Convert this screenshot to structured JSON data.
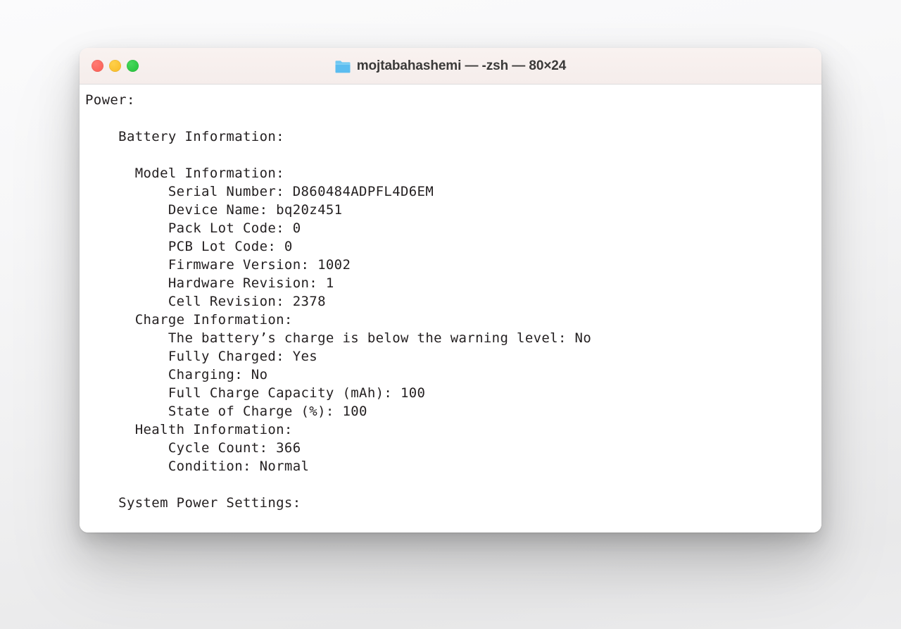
{
  "window": {
    "title": "mojtabahashemi — -zsh — 80×24",
    "folder_icon": "folder-icon",
    "traffic_lights": {
      "close": {
        "name": "close",
        "color": "#FF5F57"
      },
      "minimize": {
        "name": "minimize",
        "color": "#FEBC2E"
      },
      "maximize": {
        "name": "maximize",
        "color": "#28C840"
      }
    },
    "size": {
      "columns": 80,
      "rows": 24
    },
    "shell": "-zsh",
    "user": "mojtabahashemi"
  },
  "theme": {
    "titlebar_bg": "#F6EEEC",
    "body_bg": "#FFFFFF",
    "text_color": "#231F20",
    "separator": "#DEDCDC",
    "page_bg_top": "#FBFBFC",
    "page_bg_bottom": "#E9E9EA"
  },
  "terminal": {
    "lines": [
      "Power:",
      "",
      "    Battery Information:",
      "",
      "      Model Information:",
      "          Serial Number: D860484ADPFL4D6EM",
      "          Device Name: bq20z451",
      "          Pack Lot Code: 0",
      "          PCB Lot Code: 0",
      "          Firmware Version: 1002",
      "          Hardware Revision: 1",
      "          Cell Revision: 2378",
      "      Charge Information:",
      "          The battery’s charge is below the warning level: No",
      "          Fully Charged: Yes",
      "          Charging: No",
      "          Full Charge Capacity (mAh): 100",
      "          State of Charge (%): 100",
      "      Health Information:",
      "          Cycle Count: 366",
      "          Condition: Normal",
      "",
      "    System Power Settings:"
    ],
    "fields": {
      "serial_number": "D860484ADPFL4D6EM",
      "device_name": "bq20z451",
      "pack_lot_code": "0",
      "pcb_lot_code": "0",
      "firmware_version": "1002",
      "hardware_revision": "1",
      "cell_revision": "2378",
      "below_warning_level": "No",
      "fully_charged": "Yes",
      "charging": "No",
      "full_charge_capacity_mah": "100",
      "state_of_charge_pct": "100",
      "cycle_count": "366",
      "condition": "Normal"
    }
  }
}
